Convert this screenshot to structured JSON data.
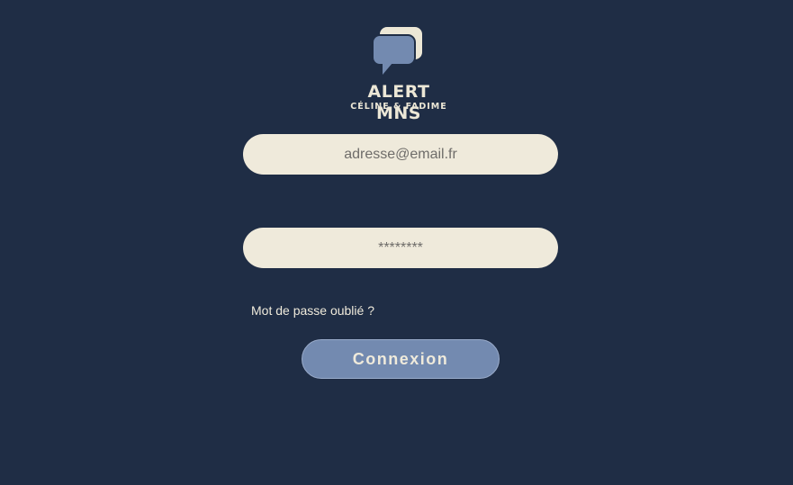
{
  "logo": {
    "title": "ALERT MNS",
    "subtitle": "CÉLINE & FADIME",
    "icon": "chat-bubbles-icon",
    "colors": {
      "back_bubble": "#ece7d6",
      "front_bubble": "#738ab0",
      "background": "#1f2d45"
    }
  },
  "form": {
    "email_placeholder": "adresse@email.fr",
    "email_value": "",
    "password_placeholder": "********",
    "password_value": "",
    "forgot_password_label": "Mot de passe oublié ?",
    "submit_label": "Connexion"
  },
  "colors": {
    "background": "#1f2d45",
    "input_background": "#efeadb",
    "button_background": "#738ab0",
    "text_light": "#efeadb"
  }
}
